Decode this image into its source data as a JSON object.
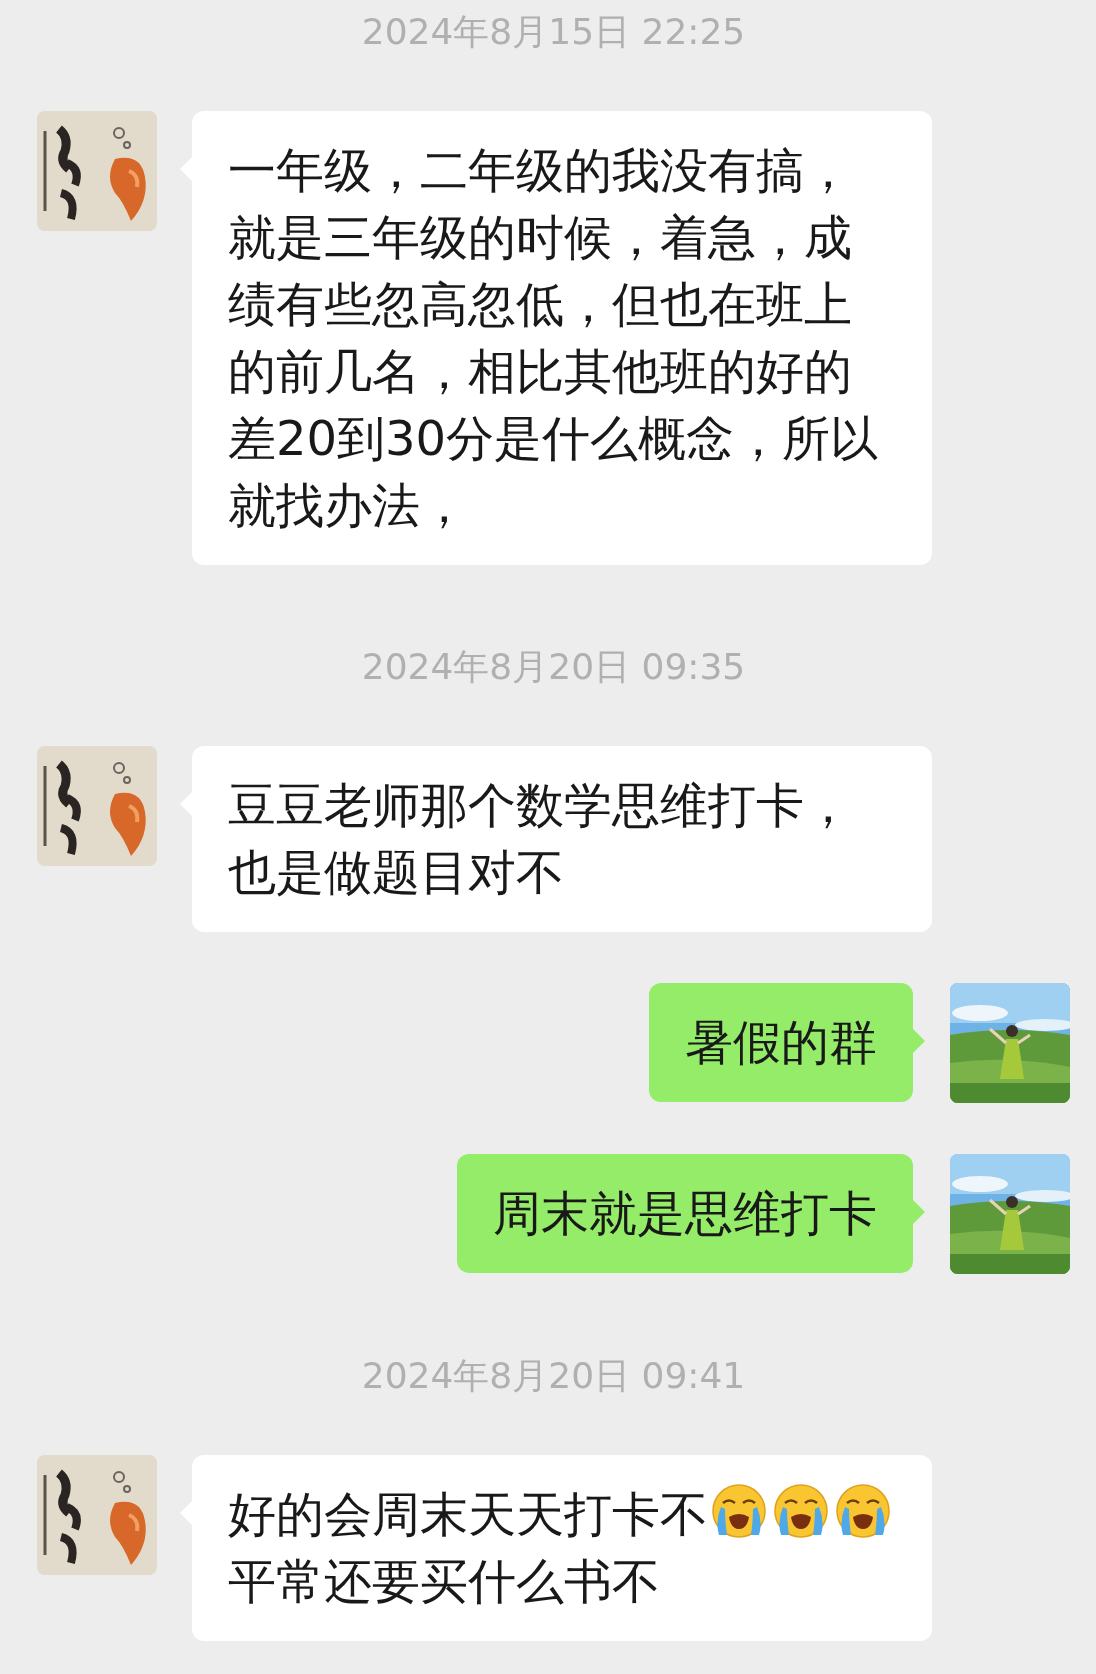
{
  "messages": [
    {
      "kind": "time",
      "text": "2024年8月15日 22:25"
    },
    {
      "kind": "message",
      "mine": false,
      "parts": [
        {
          "kind": "text",
          "text": "一年级，二年级的我没有搞，就是三年级的时候，着急，成绩有些忽高忽低，但也在班上的前几名，相比其他班的好的差20到30分是什么概念，所以就找办法，"
        }
      ]
    },
    {
      "kind": "time",
      "text": "2024年8月20日 09:35"
    },
    {
      "kind": "message",
      "mine": false,
      "parts": [
        {
          "kind": "text",
          "text": "豆豆老师那个数学思维打卡，也是做题目对不"
        }
      ]
    },
    {
      "kind": "message",
      "mine": true,
      "parts": [
        {
          "kind": "text",
          "text": "暑假的群"
        }
      ]
    },
    {
      "kind": "message",
      "mine": true,
      "parts": [
        {
          "kind": "text",
          "text": "周末就是思维打卡"
        }
      ]
    },
    {
      "kind": "time",
      "text": "2024年8月20日 09:41"
    },
    {
      "kind": "message",
      "mine": false,
      "parts": [
        {
          "kind": "text",
          "text": "好的会周末天天打卡不"
        },
        {
          "kind": "emoji"
        },
        {
          "kind": "emoji"
        },
        {
          "kind": "emoji"
        },
        {
          "kind": "text",
          "text": "平常还要买什么书不"
        }
      ]
    }
  ]
}
